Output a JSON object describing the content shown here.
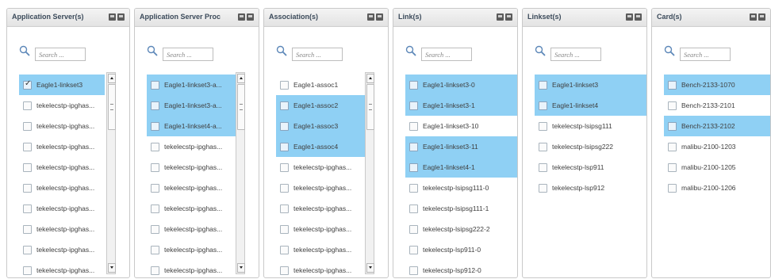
{
  "search_placeholder": "Search ...",
  "accent": {
    "selected_row": "#8fd0f4",
    "header_text": "#3b4a5a"
  },
  "icons": {
    "search": "magnifier-icon",
    "header_buttons": [
      "minimize-icon",
      "maximize-icon"
    ]
  },
  "panels": [
    {
      "title": "Application Server(s)",
      "search_value": "",
      "items": [
        {
          "label": "Eagle1-linkset3",
          "checked": true,
          "selected": true
        },
        {
          "label": "tekelecstp-ipghas...",
          "checked": false,
          "selected": false
        },
        {
          "label": "tekelecstp-ipghas...",
          "checked": false,
          "selected": false
        },
        {
          "label": "tekelecstp-ipghas...",
          "checked": false,
          "selected": false
        },
        {
          "label": "tekelecstp-ipghas...",
          "checked": false,
          "selected": false
        },
        {
          "label": "tekelecstp-ipghas...",
          "checked": false,
          "selected": false
        },
        {
          "label": "tekelecstp-ipghas...",
          "checked": false,
          "selected": false
        },
        {
          "label": "tekelecstp-ipghas...",
          "checked": false,
          "selected": false
        },
        {
          "label": "tekelecstp-ipghas...",
          "checked": false,
          "selected": false
        },
        {
          "label": "tekelecstp-ipghas...",
          "checked": false,
          "selected": false
        }
      ],
      "scrollbar": true
    },
    {
      "title": "Application Server Proc",
      "search_value": "",
      "items": [
        {
          "label": "Eagle1-linkset3-a...",
          "checked": false,
          "selected": true
        },
        {
          "label": "Eagle1-linkset3-a...",
          "checked": false,
          "selected": true
        },
        {
          "label": "Eagle1-linkset4-a...",
          "checked": false,
          "selected": true
        },
        {
          "label": "tekelecstp-ipghas...",
          "checked": false,
          "selected": false
        },
        {
          "label": "tekelecstp-ipghas...",
          "checked": false,
          "selected": false
        },
        {
          "label": "tekelecstp-ipghas...",
          "checked": false,
          "selected": false
        },
        {
          "label": "tekelecstp-ipghas...",
          "checked": false,
          "selected": false
        },
        {
          "label": "tekelecstp-ipghas...",
          "checked": false,
          "selected": false
        },
        {
          "label": "tekelecstp-ipghas...",
          "checked": false,
          "selected": false
        },
        {
          "label": "tekelecstp-ipghas...",
          "checked": false,
          "selected": false
        }
      ],
      "scrollbar": true
    },
    {
      "title": "Association(s)",
      "search_value": "",
      "items": [
        {
          "label": "Eagle1-assoc1",
          "checked": false,
          "selected": false
        },
        {
          "label": "Eagle1-assoc2",
          "checked": false,
          "selected": true
        },
        {
          "label": "Eagle1-assoc3",
          "checked": false,
          "selected": true
        },
        {
          "label": "Eagle1-assoc4",
          "checked": false,
          "selected": true
        },
        {
          "label": "tekelecstp-ipghas...",
          "checked": false,
          "selected": false
        },
        {
          "label": "tekelecstp-ipghas...",
          "checked": false,
          "selected": false
        },
        {
          "label": "tekelecstp-ipghas...",
          "checked": false,
          "selected": false
        },
        {
          "label": "tekelecstp-ipghas...",
          "checked": false,
          "selected": false
        },
        {
          "label": "tekelecstp-ipghas...",
          "checked": false,
          "selected": false
        },
        {
          "label": "tekelecstp-ipghas...",
          "checked": false,
          "selected": false
        }
      ],
      "scrollbar": true
    },
    {
      "title": "Link(s)",
      "search_value": "",
      "items": [
        {
          "label": "Eagle1-linkset3-0",
          "checked": false,
          "selected": true
        },
        {
          "label": "Eagle1-linkset3-1",
          "checked": false,
          "selected": true
        },
        {
          "label": "Eagle1-linkset3-10",
          "checked": false,
          "selected": false
        },
        {
          "label": "Eagle1-linkset3-11",
          "checked": false,
          "selected": true
        },
        {
          "label": "Eagle1-linkset4-1",
          "checked": false,
          "selected": true
        },
        {
          "label": "tekelecstp-lsipsg111-0",
          "checked": false,
          "selected": false
        },
        {
          "label": "tekelecstp-lsipsg111-1",
          "checked": false,
          "selected": false
        },
        {
          "label": "tekelecstp-lsipsg222-2",
          "checked": false,
          "selected": false
        },
        {
          "label": "tekelecstp-lsp911-0",
          "checked": false,
          "selected": false
        },
        {
          "label": "tekelecstp-lsp912-0",
          "checked": false,
          "selected": false
        }
      ],
      "scrollbar": false
    },
    {
      "title": "Linkset(s)",
      "search_value": "",
      "items": [
        {
          "label": "Eagle1-linkset3",
          "checked": false,
          "selected": true
        },
        {
          "label": "Eagle1-linkset4",
          "checked": false,
          "selected": true
        },
        {
          "label": "tekelecstp-lsipsg111",
          "checked": false,
          "selected": false
        },
        {
          "label": "tekelecstp-lsipsg222",
          "checked": false,
          "selected": false
        },
        {
          "label": "tekelecstp-lsp911",
          "checked": false,
          "selected": false
        },
        {
          "label": "tekelecstp-lsp912",
          "checked": false,
          "selected": false
        }
      ],
      "scrollbar": false
    },
    {
      "title": "Card(s)",
      "search_value": "",
      "items": [
        {
          "label": "Bench-2133-1070",
          "checked": false,
          "selected": true
        },
        {
          "label": "Bench-2133-2101",
          "checked": false,
          "selected": false
        },
        {
          "label": "Bench-2133-2102",
          "checked": false,
          "selected": true
        },
        {
          "label": "malibu-2100-1203",
          "checked": false,
          "selected": false
        },
        {
          "label": "malibu-2100-1205",
          "checked": false,
          "selected": false
        },
        {
          "label": "malibu-2100-1206",
          "checked": false,
          "selected": false
        }
      ],
      "scrollbar": false
    }
  ]
}
